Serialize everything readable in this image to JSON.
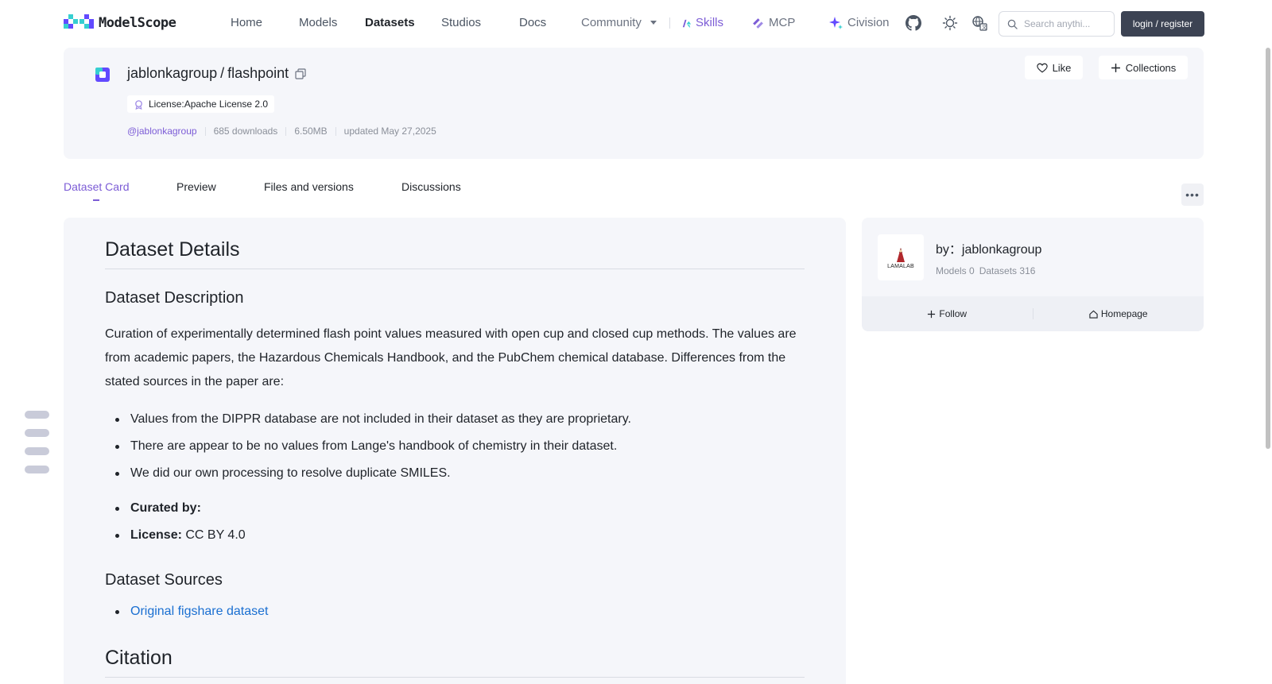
{
  "brand": {
    "name": "ModelScope",
    "accent": "#7c5cd6",
    "link": "#1a6fd1"
  },
  "nav": {
    "home": "Home",
    "models": "Models",
    "datasets": "Datasets",
    "studios": "Studios",
    "docs": "Docs",
    "community": "Community",
    "skills": "Skills",
    "mcp": "MCP",
    "civision": "Civision",
    "search_placeholder": "Search anythi...",
    "login": "login / register"
  },
  "repo": {
    "owner": "jablonkagroup",
    "slash": "/",
    "name": "flashpoint",
    "license": "License:Apache License 2.0",
    "owner_handle": "@jablonkagroup",
    "downloads": "685 downloads",
    "size": "6.50MB",
    "updated": "updated May 27,2025",
    "like": "Like",
    "collections": "Collections"
  },
  "tabs": [
    "Dataset Card",
    "Preview",
    "Files and versions",
    "Discussions"
  ],
  "readme": {
    "h_details": "Dataset Details",
    "h_description": "Dataset Description",
    "description": "Curation of experimentally determined flash point values measured with open cup and closed cup methods. The values are from academic papers, the Hazardous Chemicals Handbook, and the PubChem chemical database. Differences from the stated sources in the paper are:",
    "differences": [
      "Values from the DIPPR database are not included in their dataset as they are proprietary.",
      "There are appear to be no values from Lange's handbook of chemistry in their dataset.",
      "We did our own processing to resolve duplicate SMILES."
    ],
    "curated_label": "Curated by:",
    "license_label": "License:",
    "license_value": "CC BY 4.0",
    "h_sources": "Dataset Sources",
    "source_link": "Original figshare dataset",
    "h_citation": "Citation"
  },
  "author": {
    "by": "by：jablonkagroup",
    "avatar_text": "LAMALAB",
    "models": "Models 0",
    "datasets": "Datasets 316",
    "follow": "Follow",
    "homepage": "Homepage"
  }
}
